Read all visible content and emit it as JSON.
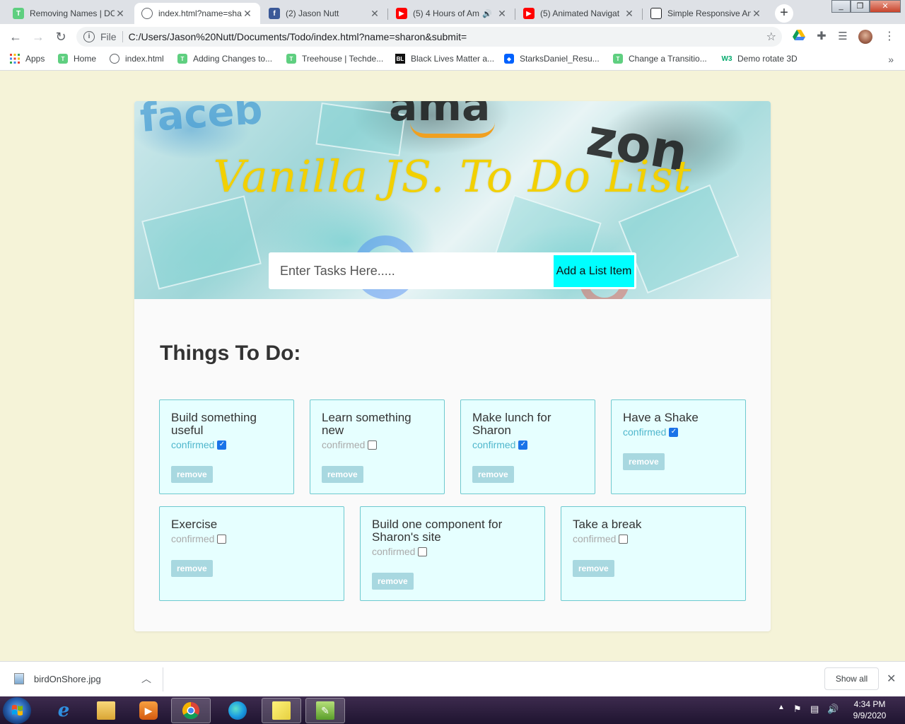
{
  "browser": {
    "tabs": [
      {
        "title": "Removing Names | DC",
        "icon": "treehouse-icon",
        "color": "#5fcf80"
      },
      {
        "title": "index.html?name=sha",
        "icon": "globe-icon",
        "color": "#5f6368"
      },
      {
        "title": "(2) Jason Nutt",
        "icon": "facebook-icon",
        "color": "#3b5998"
      },
      {
        "title": "(5) 4 Hours of Am",
        "icon": "youtube-icon",
        "color": "#ff0000"
      },
      {
        "title": "(5) Animated Navigat",
        "icon": "youtube-icon",
        "color": "#ff0000"
      },
      {
        "title": "Simple Responsive An",
        "icon": "codepen-icon",
        "color": "#202124"
      }
    ],
    "url_scheme": "File",
    "url": "C:/Users/Jason%20Nutt/Documents/Todo/index.html?name=sharon&submit=",
    "bookmarks": [
      {
        "label": "Apps",
        "icon": "apps-grid-icon"
      },
      {
        "label": "Home",
        "icon": "treehouse-icon"
      },
      {
        "label": "index.html",
        "icon": "globe-icon"
      },
      {
        "label": "Adding Changes to...",
        "icon": "treehouse-icon"
      },
      {
        "label": "Treehouse | Techde...",
        "icon": "treehouse-icon"
      },
      {
        "label": "Black Lives Matter a...",
        "icon": "blm-icon"
      },
      {
        "label": "StarksDaniel_Resu...",
        "icon": "dropbox-icon"
      },
      {
        "label": "Change a Transitio...",
        "icon": "treehouse-icon"
      },
      {
        "label": "Demo rotate 3D",
        "icon": "w3schools-icon"
      }
    ]
  },
  "page": {
    "title": "Vanilla JS. To Do List",
    "input_placeholder": "Enter Tasks Here.....",
    "add_button": "Add a List Item",
    "heading": "Things To Do:",
    "confirmed_label": "confirmed",
    "remove_label": "remove",
    "hero_fragments": [
      "faceb",
      "ama",
      "zon"
    ],
    "items": [
      {
        "title": "Build something useful",
        "confirmed": true
      },
      {
        "title": "Learn something new",
        "confirmed": false
      },
      {
        "title": "Make lunch for Sharon",
        "confirmed": true
      },
      {
        "title": "Have a Shake",
        "confirmed": true
      },
      {
        "title": "Exercise",
        "confirmed": false
      },
      {
        "title": "Build one component for Sharon's site",
        "confirmed": false
      },
      {
        "title": "Take a break",
        "confirmed": false
      }
    ]
  },
  "downloads": {
    "file_name": "birdOnShore.jpg",
    "show_all": "Show all"
  },
  "taskbar": {
    "time": "4:34 PM",
    "date": "9/9/2020",
    "apps": [
      "internet-explorer-icon",
      "file-explorer-icon",
      "media-player-icon",
      "chrome-icon",
      "edge-icon",
      "sticky-notes-icon",
      "notepad-plus-icon"
    ]
  },
  "colors": {
    "page_bg": "#f5f3d8",
    "title_yellow": "#f2d000",
    "add_button": "#00ffff",
    "item_bg": "#e6ffff",
    "item_border": "#6ec9cf",
    "confirmed_on": "#4fb6cc",
    "remove_button": "#a8d8e0"
  }
}
